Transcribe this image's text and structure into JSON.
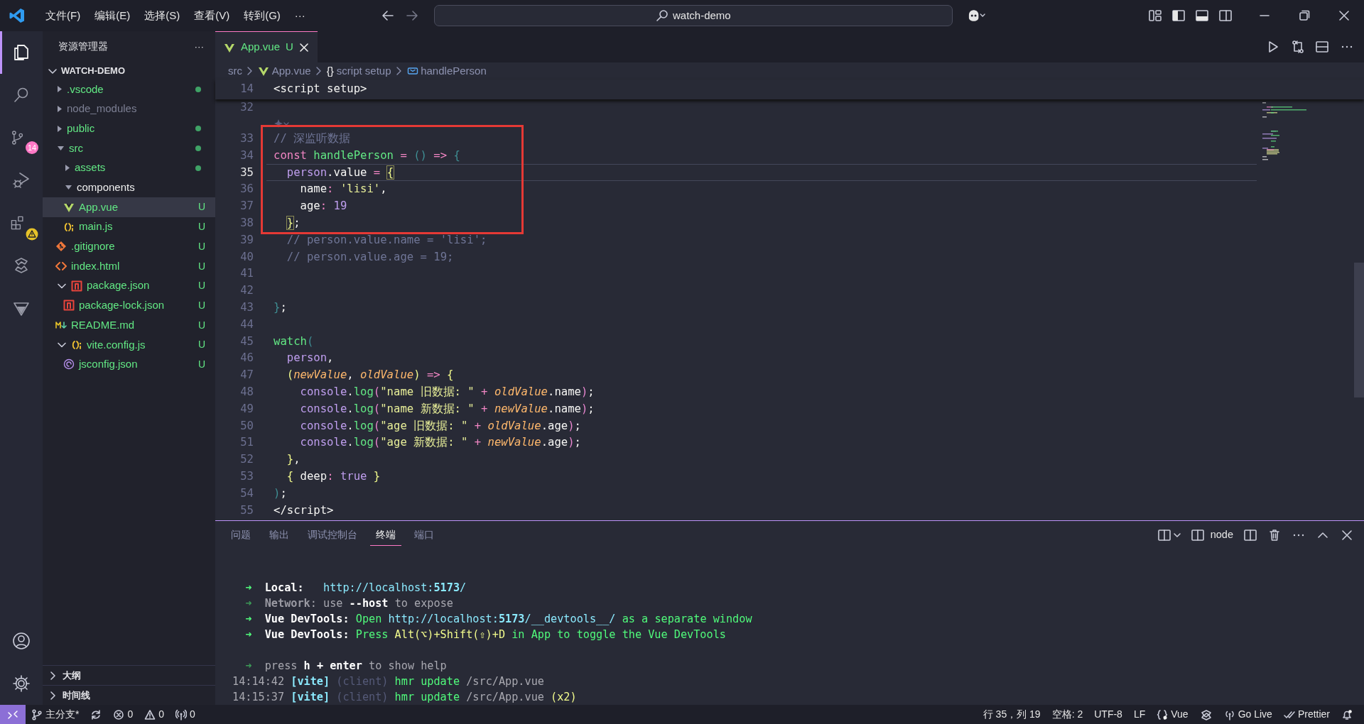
{
  "menu": [
    "文件(F)",
    "编辑(E)",
    "选择(S)",
    "查看(V)",
    "转到(G)",
    "···"
  ],
  "search": {
    "value": "watch-demo"
  },
  "activity_bar": [
    {
      "kind": "explorer",
      "selected": true,
      "warning": false
    },
    {
      "kind": "search",
      "selected": false,
      "warning": false
    },
    {
      "kind": "source-control",
      "selected": false,
      "warning": false,
      "badge": "14"
    },
    {
      "kind": "run-debug",
      "selected": false,
      "warning": false
    },
    {
      "kind": "extensions",
      "selected": false,
      "warning": true
    },
    {
      "kind": "swirl",
      "selected": false,
      "warning": false
    },
    {
      "kind": "triangle",
      "selected": false,
      "warning": false
    }
  ],
  "activity_bottom": [
    {
      "kind": "account"
    },
    {
      "kind": "settings"
    }
  ],
  "sidebar": {
    "title": "资源管理器",
    "more": "···",
    "section": "WATCH-DEMO",
    "items": [
      {
        "label": ".vscode",
        "kind": "folder",
        "expanded": false,
        "untracked": true,
        "ignored": false,
        "dot": true,
        "selected": false
      },
      {
        "label": "node_modules",
        "kind": "folder",
        "expanded": false,
        "ignored": true,
        "dot": false,
        "selected": false
      },
      {
        "label": "public",
        "kind": "folder",
        "expanded": false,
        "untracked": true,
        "ignored": false,
        "dot": true,
        "selected": false
      },
      {
        "label": "src",
        "kind": "folder",
        "expanded": true,
        "untracked": true,
        "ignored": false,
        "dot": true,
        "selected": false,
        "children": [
          {
            "label": "assets",
            "kind": "folder",
            "expanded": false,
            "untracked": true,
            "ignored": false,
            "dot": true,
            "selected": false
          },
          {
            "label": "components",
            "kind": "folder",
            "expanded": true,
            "untracked": false,
            "ignored": false,
            "dot": false,
            "selected": false
          },
          {
            "label": "App.vue",
            "kind": "vue",
            "untracked": true,
            "ignored": false,
            "dot": false,
            "badge": "U",
            "selected": true
          },
          {
            "label": "main.js",
            "kind": "js",
            "untracked": true,
            "ignored": false,
            "dot": false,
            "badge": "U",
            "selected": false
          }
        ]
      },
      {
        "label": ".gitignore",
        "kind": "git",
        "untracked": true,
        "ignored": false,
        "dot": false,
        "badge": "U",
        "selected": false
      },
      {
        "label": "index.html",
        "kind": "html",
        "untracked": true,
        "ignored": false,
        "dot": false,
        "badge": "U",
        "selected": false
      },
      {
        "label": "package.json",
        "kind": "npm",
        "expanded": true,
        "untracked": true,
        "ignored": false,
        "dot": false,
        "badge": "U",
        "selected": false,
        "children": [
          {
            "label": "package-lock.json",
            "kind": "npm",
            "untracked": true,
            "ignored": false,
            "dot": false,
            "badge": "U",
            "selected": false
          }
        ]
      },
      {
        "label": "README.md",
        "kind": "markdown",
        "untracked": true,
        "ignored": false,
        "dot": false,
        "badge": "U",
        "selected": false
      },
      {
        "label": "vite.config.js",
        "kind": "js",
        "expanded": true,
        "untracked": true,
        "ignored": false,
        "dot": false,
        "badge": "U",
        "selected": false,
        "children": [
          {
            "label": "jsconfig.json",
            "kind": "jsconfig",
            "untracked": true,
            "ignored": false,
            "dot": false,
            "badge": "U",
            "selected": false
          }
        ]
      }
    ],
    "bottom_sections": [
      "大纲",
      "时间线"
    ]
  },
  "tabs": [
    {
      "label": "App.vue",
      "status": "U",
      "selected": true
    }
  ],
  "breadcrumbs": [
    {
      "label": "src",
      "kind": "folder"
    },
    {
      "label": "App.vue",
      "kind": "vue"
    },
    {
      "label": "script setup",
      "kind": "scope",
      "glyph": "{}"
    },
    {
      "label": "handlePerson",
      "kind": "symbol"
    }
  ],
  "sticky_line": {
    "n": "14",
    "tokens": [
      {
        "t": "<script setup>",
        "kind": "plain"
      }
    ]
  },
  "code_lines": [
    {
      "kind": "code",
      "n": "32",
      "current": false,
      "boxed": false
    },
    {
      "kind": "codelens",
      "current": false,
      "boxed": true
    },
    {
      "kind": "code",
      "n": "33",
      "current": false,
      "boxed": true,
      "tokens": [
        {
          "t": "// 深监听数据",
          "kind": "cmt"
        }
      ]
    },
    {
      "kind": "code",
      "n": "34",
      "current": false,
      "boxed": true,
      "tokens": [
        {
          "t": "const",
          "kind": "kw"
        },
        {
          "t": " handlePerson",
          "kind": "fn"
        },
        {
          "t": " =",
          "kind": "op"
        },
        {
          "t": " ()",
          "kind": "b3"
        },
        {
          "t": " =>",
          "kind": "op"
        },
        {
          "t": " {",
          "kind": "b3"
        }
      ]
    },
    {
      "kind": "code",
      "n": "35",
      "current": true,
      "boxed": true,
      "tokens": [
        {
          "t": "  person",
          "kind": "var"
        },
        {
          "t": ".value",
          "kind": "plain"
        },
        {
          "t": " = ",
          "kind": "op"
        },
        {
          "t": "{",
          "kind": "bm"
        }
      ]
    },
    {
      "kind": "code",
      "n": "36",
      "current": false,
      "boxed": true,
      "tokens": [
        {
          "t": "    name",
          "kind": "plain"
        },
        {
          "t": ":",
          "kind": "op"
        },
        {
          "t": " 'lisi'",
          "kind": "str"
        },
        {
          "t": ",",
          "kind": "plain"
        }
      ]
    },
    {
      "kind": "code",
      "n": "37",
      "current": false,
      "boxed": true,
      "tokens": [
        {
          "t": "    age",
          "kind": "plain"
        },
        {
          "t": ":",
          "kind": "op"
        },
        {
          "t": " 19",
          "kind": "num"
        }
      ]
    },
    {
      "kind": "code",
      "n": "38",
      "current": false,
      "boxed": true,
      "tokens": [
        {
          "t": "  }",
          "kind": "bm"
        },
        {
          "t": ";",
          "kind": "plain"
        }
      ]
    },
    {
      "kind": "code",
      "n": "39",
      "current": false,
      "boxed": false,
      "tokens": [
        {
          "t": "  // person.value.name = 'lisi';",
          "kind": "cmt"
        }
      ]
    },
    {
      "kind": "code",
      "n": "40",
      "current": false,
      "boxed": false,
      "tokens": [
        {
          "t": "  // person.value.age = 19;",
          "kind": "cmt"
        }
      ]
    },
    {
      "kind": "code",
      "n": "41",
      "current": false,
      "boxed": false
    },
    {
      "kind": "code",
      "n": "42",
      "current": false,
      "boxed": false
    },
    {
      "kind": "code",
      "n": "43",
      "current": false,
      "boxed": false,
      "tokens": [
        {
          "t": "}",
          "kind": "b3"
        },
        {
          "t": ";",
          "kind": "plain"
        }
      ]
    },
    {
      "kind": "code",
      "n": "44",
      "current": false,
      "boxed": false
    },
    {
      "kind": "code",
      "n": "45",
      "current": false,
      "boxed": false,
      "tokens": [
        {
          "t": "watch",
          "kind": "fn"
        },
        {
          "t": "(",
          "kind": "b3"
        }
      ]
    },
    {
      "kind": "code",
      "n": "46",
      "current": false,
      "boxed": false,
      "tokens": [
        {
          "t": "  person",
          "kind": "var"
        },
        {
          "t": ",",
          "kind": "plain"
        }
      ]
    },
    {
      "kind": "code",
      "n": "47",
      "current": false,
      "boxed": false,
      "tokens": [
        {
          "t": "  (",
          "kind": "b1"
        },
        {
          "t": "newValue",
          "kind": "param"
        },
        {
          "t": ",",
          "kind": "plain"
        },
        {
          "t": " oldValue",
          "kind": "param"
        },
        {
          "t": ")",
          "kind": "b1"
        },
        {
          "t": " =>",
          "kind": "op"
        },
        {
          "t": " {",
          "kind": "b1"
        }
      ]
    },
    {
      "kind": "code",
      "n": "48",
      "current": false,
      "boxed": false,
      "tokens": [
        {
          "t": "    console",
          "kind": "var"
        },
        {
          "t": ".",
          "kind": "plain"
        },
        {
          "t": "log",
          "kind": "fn"
        },
        {
          "t": "(",
          "kind": "b2"
        },
        {
          "t": "\"name 旧数据: \"",
          "kind": "str"
        },
        {
          "t": " +",
          "kind": "op"
        },
        {
          "t": " oldValue",
          "kind": "param"
        },
        {
          "t": ".name",
          "kind": "plain"
        },
        {
          "t": ")",
          "kind": "b2"
        },
        {
          "t": ";",
          "kind": "plain"
        }
      ]
    },
    {
      "kind": "code",
      "n": "49",
      "current": false,
      "boxed": false,
      "tokens": [
        {
          "t": "    console",
          "kind": "var"
        },
        {
          "t": ".",
          "kind": "plain"
        },
        {
          "t": "log",
          "kind": "fn"
        },
        {
          "t": "(",
          "kind": "b2"
        },
        {
          "t": "\"name 新数据: \"",
          "kind": "str"
        },
        {
          "t": " +",
          "kind": "op"
        },
        {
          "t": " newValue",
          "kind": "param"
        },
        {
          "t": ".name",
          "kind": "plain"
        },
        {
          "t": ")",
          "kind": "b2"
        },
        {
          "t": ";",
          "kind": "plain"
        }
      ]
    },
    {
      "kind": "code",
      "n": "50",
      "current": false,
      "boxed": false,
      "tokens": [
        {
          "t": "    console",
          "kind": "var"
        },
        {
          "t": ".",
          "kind": "plain"
        },
        {
          "t": "log",
          "kind": "fn"
        },
        {
          "t": "(",
          "kind": "b2"
        },
        {
          "t": "\"age 旧数据: \"",
          "kind": "str"
        },
        {
          "t": " +",
          "kind": "op"
        },
        {
          "t": " oldValue",
          "kind": "param"
        },
        {
          "t": ".age",
          "kind": "plain"
        },
        {
          "t": ")",
          "kind": "b2"
        },
        {
          "t": ";",
          "kind": "plain"
        }
      ]
    },
    {
      "kind": "code",
      "n": "51",
      "current": false,
      "boxed": false,
      "tokens": [
        {
          "t": "    console",
          "kind": "var"
        },
        {
          "t": ".",
          "kind": "plain"
        },
        {
          "t": "log",
          "kind": "fn"
        },
        {
          "t": "(",
          "kind": "b2"
        },
        {
          "t": "\"age 新数据: \"",
          "kind": "str"
        },
        {
          "t": " +",
          "kind": "op"
        },
        {
          "t": " newValue",
          "kind": "param"
        },
        {
          "t": ".age",
          "kind": "plain"
        },
        {
          "t": ")",
          "kind": "b2"
        },
        {
          "t": ";",
          "kind": "plain"
        }
      ]
    },
    {
      "kind": "code",
      "n": "52",
      "current": false,
      "boxed": false,
      "tokens": [
        {
          "t": "  }",
          "kind": "b1"
        },
        {
          "t": ",",
          "kind": "plain"
        }
      ]
    },
    {
      "kind": "code",
      "n": "53",
      "current": false,
      "boxed": false,
      "tokens": [
        {
          "t": "  {",
          "kind": "b1"
        },
        {
          "t": " deep",
          "kind": "plain"
        },
        {
          "t": ":",
          "kind": "op"
        },
        {
          "t": " true",
          "kind": "var"
        },
        {
          "t": " }",
          "kind": "b1"
        }
      ]
    },
    {
      "kind": "code",
      "n": "54",
      "current": false,
      "boxed": false,
      "tokens": [
        {
          "t": ")",
          "kind": "b3"
        },
        {
          "t": ";",
          "kind": "plain"
        }
      ]
    },
    {
      "kind": "code",
      "n": "55",
      "current": false,
      "boxed": false,
      "tokens": [
        {
          "t": "</script>",
          "kind": "plain"
        }
      ]
    }
  ],
  "panel": {
    "tabs": [
      {
        "label": "问题",
        "selected": false
      },
      {
        "label": "输出",
        "selected": false
      },
      {
        "label": "调试控制台",
        "selected": false
      },
      {
        "label": "终端",
        "selected": true
      },
      {
        "label": "端口",
        "selected": false
      }
    ],
    "terminal_name": "node",
    "terminal_lines": [
      {
        "kind": "blank"
      },
      {
        "kind": "blank"
      },
      {
        "kind": "output",
        "segs": [
          {
            "t": "  ➜  ",
            "kind": "arrow"
          },
          {
            "t": "Local:",
            "kind": "bold"
          },
          {
            "t": "   http://localhost:",
            "kind": "url"
          },
          {
            "t": "5173",
            "kind": "urlbold"
          },
          {
            "t": "/",
            "kind": "url"
          }
        ]
      },
      {
        "kind": "output",
        "segs": [
          {
            "t": "  ➜  ",
            "kind": "arrowdim"
          },
          {
            "t": "Network",
            "kind": "dimbold"
          },
          {
            "t": ": use ",
            "kind": "grey"
          },
          {
            "t": "--host",
            "kind": "bold"
          },
          {
            "t": " to expose",
            "kind": "grey"
          }
        ]
      },
      {
        "kind": "output",
        "segs": [
          {
            "t": "  ➜  ",
            "kind": "arrow"
          },
          {
            "t": "Vue DevTools:",
            "kind": "bold"
          },
          {
            "t": " Open ",
            "kind": "green"
          },
          {
            "t": "http://localhost:",
            "kind": "url"
          },
          {
            "t": "5173",
            "kind": "urlbold"
          },
          {
            "t": "/__devtools__/",
            "kind": "url"
          },
          {
            "t": " as a separate window",
            "kind": "green"
          }
        ]
      },
      {
        "kind": "output",
        "segs": [
          {
            "t": "  ➜  ",
            "kind": "arrow"
          },
          {
            "t": "Vue DevTools:",
            "kind": "bold"
          },
          {
            "t": " Press ",
            "kind": "green"
          },
          {
            "t": "Alt(⌥)+Shift(⇧)+D",
            "kind": "yellow"
          },
          {
            "t": " in App to toggle the Vue DevTools",
            "kind": "green"
          }
        ]
      },
      {
        "kind": "blank"
      },
      {
        "kind": "output",
        "segs": [
          {
            "t": "  ➜  ",
            "kind": "arrowdim"
          },
          {
            "t": "press ",
            "kind": "grey"
          },
          {
            "t": "h + enter",
            "kind": "bold"
          },
          {
            "t": " to show help",
            "kind": "grey"
          }
        ]
      },
      {
        "kind": "output",
        "segs": [
          {
            "t": "14:14:42 ",
            "kind": "grey"
          },
          {
            "t": "[vite]",
            "kind": "cyanbold"
          },
          {
            "t": " (client)",
            "kind": "faint"
          },
          {
            "t": " hmr update",
            "kind": "green"
          },
          {
            "t": " /src/App.vue",
            "kind": "grey"
          }
        ]
      },
      {
        "kind": "output",
        "segs": [
          {
            "t": "14:15:37 ",
            "kind": "grey"
          },
          {
            "t": "[vite]",
            "kind": "cyanbold"
          },
          {
            "t": " (client)",
            "kind": "faint"
          },
          {
            "t": " hmr update",
            "kind": "green"
          },
          {
            "t": " /src/App.vue",
            "kind": "grey"
          },
          {
            "t": " (x2)",
            "kind": "yellow"
          }
        ]
      }
    ]
  },
  "status_bar": {
    "left": [
      {
        "kind": "remote"
      },
      {
        "kind": "branch",
        "label": "主分支*"
      },
      {
        "kind": "sync"
      },
      {
        "kind": "errors",
        "label": "0"
      },
      {
        "kind": "warnings",
        "label": "0"
      },
      {
        "kind": "ports",
        "label": "0"
      }
    ],
    "right": [
      {
        "kind": "text",
        "label": "行 35，列 19"
      },
      {
        "kind": "text",
        "label": "空格: 2"
      },
      {
        "kind": "text",
        "label": "UTF-8"
      },
      {
        "kind": "text",
        "label": "LF"
      },
      {
        "kind": "language",
        "label": "Vue"
      },
      {
        "kind": "extension"
      },
      {
        "kind": "golive",
        "label": "Go Live"
      },
      {
        "kind": "prettier",
        "label": "Prettier"
      },
      {
        "kind": "bell"
      }
    ]
  }
}
